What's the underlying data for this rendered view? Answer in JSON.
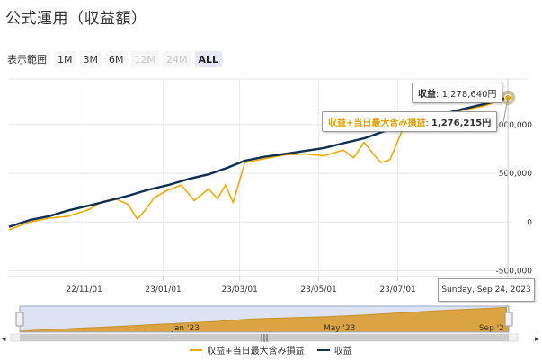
{
  "page": {
    "title": "公式運用（収益額）"
  },
  "range_selector": {
    "label": "表示範囲",
    "buttons": [
      {
        "label": "1M",
        "state": "normal"
      },
      {
        "label": "3M",
        "state": "normal"
      },
      {
        "label": "6M",
        "state": "normal"
      },
      {
        "label": "12M",
        "state": "disabled"
      },
      {
        "label": "24M",
        "state": "disabled"
      },
      {
        "label": "ALL",
        "state": "active"
      }
    ]
  },
  "tooltip": {
    "date": "Sunday, Sep 24, 2023",
    "profit_label": "収益",
    "profit_value": "1,278,640円",
    "combined_label": "収益+当日最大含み損益",
    "combined_value": "1,276,215円"
  },
  "navigator": {
    "labels": [
      "Jan '23",
      "May '23",
      "Sep '2"
    ]
  },
  "legend": {
    "items": [
      {
        "label": "収益+当日最大含み損益",
        "color": "#f0a800"
      },
      {
        "label": "収益",
        "color": "#0d2f52"
      }
    ]
  },
  "chart_data": {
    "type": "line",
    "x_ticks": [
      "22/11/01",
      "23/01/01",
      "23/03/01",
      "23/05/01",
      "23/07/01"
    ],
    "y_ticks": [
      "-500,000",
      "0",
      "500,000",
      "1,000,000"
    ],
    "ylim": [
      -560000,
      1470000
    ],
    "xlim": [
      "2022-09-04",
      "2023-09-26"
    ],
    "grid": true,
    "legend_position": "bottom",
    "series": [
      {
        "name": "収益",
        "color": "#0d2f52",
        "x": [
          "2022-09-04",
          "2022-09-20",
          "2022-10-05",
          "2022-10-20",
          "2022-11-05",
          "2022-11-20",
          "2022-12-05",
          "2022-12-20",
          "2023-01-05",
          "2023-01-20",
          "2023-02-05",
          "2023-02-20",
          "2023-03-05",
          "2023-03-20",
          "2023-04-05",
          "2023-04-20",
          "2023-05-05",
          "2023-05-20",
          "2023-06-05",
          "2023-06-20",
          "2023-07-05",
          "2023-07-20",
          "2023-08-05",
          "2023-08-20",
          "2023-09-05",
          "2023-09-24"
        ],
        "values": [
          -50000,
          20000,
          60000,
          120000,
          170000,
          220000,
          270000,
          330000,
          380000,
          440000,
          490000,
          560000,
          630000,
          670000,
          700000,
          730000,
          760000,
          810000,
          860000,
          930000,
          990000,
          1050000,
          1110000,
          1160000,
          1210000,
          1278640
        ]
      },
      {
        "name": "収益+当日最大含み損益",
        "color": "#f0a800",
        "x": [
          "2022-09-04",
          "2022-09-20",
          "2022-10-05",
          "2022-10-20",
          "2022-11-05",
          "2022-11-15",
          "2022-11-25",
          "2022-12-05",
          "2022-12-12",
          "2022-12-18",
          "2022-12-25",
          "2023-01-05",
          "2023-01-15",
          "2023-01-25",
          "2023-02-05",
          "2023-02-12",
          "2023-02-18",
          "2023-02-24",
          "2023-03-05",
          "2023-03-20",
          "2023-04-05",
          "2023-04-20",
          "2023-05-05",
          "2023-05-20",
          "2023-05-28",
          "2023-06-05",
          "2023-06-12",
          "2023-06-18",
          "2023-06-25",
          "2023-07-05",
          "2023-07-20",
          "2023-08-05",
          "2023-08-20",
          "2023-09-05",
          "2023-09-24"
        ],
        "values": [
          -80000,
          0,
          40000,
          60000,
          130000,
          210000,
          240000,
          180000,
          30000,
          120000,
          250000,
          330000,
          380000,
          220000,
          340000,
          240000,
          380000,
          200000,
          610000,
          650000,
          690000,
          700000,
          680000,
          740000,
          660000,
          820000,
          700000,
          610000,
          640000,
          960000,
          1020000,
          1100000,
          1150000,
          1190000,
          1276215
        ]
      }
    ]
  }
}
